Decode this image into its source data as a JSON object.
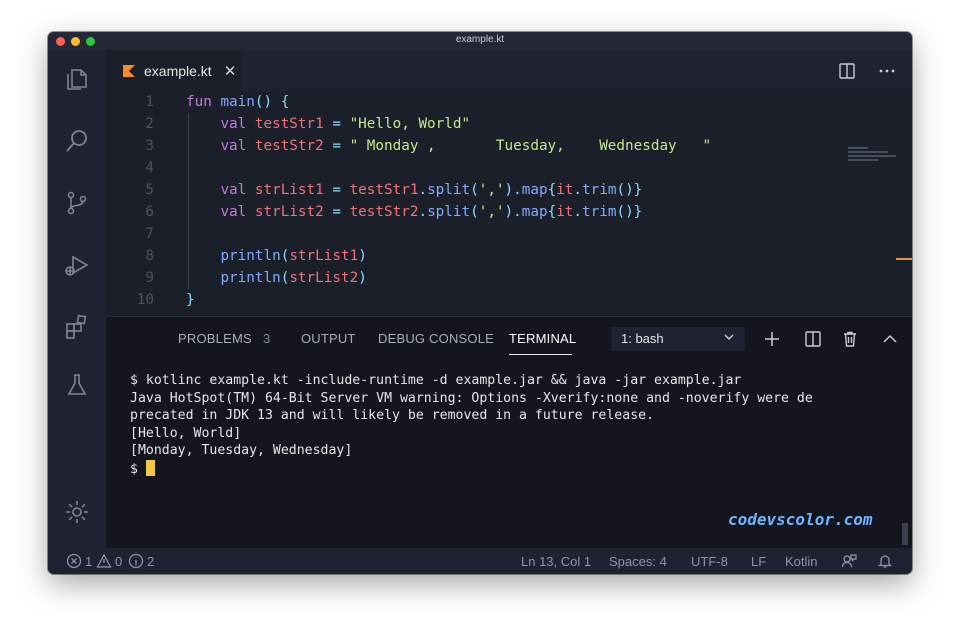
{
  "window": {
    "title": "example.kt"
  },
  "activity_bar": {
    "icons": [
      "files-icon",
      "search-icon",
      "source-control-icon",
      "debug-icon",
      "extensions-icon",
      "flask-icon",
      "gear-icon"
    ]
  },
  "editor": {
    "tab": {
      "label": "example.kt",
      "close": "✕"
    },
    "line_numbers": [
      "1",
      "2",
      "3",
      "4",
      "5",
      "6",
      "7",
      "8",
      "9",
      "10"
    ]
  },
  "panel": {
    "tabs": {
      "problems": "PROBLEMS",
      "problems_count": "3",
      "output": "OUTPUT",
      "debug_console": "DEBUG CONSOLE",
      "terminal": "TERMINAL"
    },
    "terminal_select": "1: bash",
    "terminal_lines": [
      "$ kotlinc example.kt -include-runtime -d example.jar && java -jar example.jar",
      "Java HotSpot(TM) 64-Bit Server VM warning: Options -Xverify:none and -noverify were de",
      "precated in JDK 13 and will likely be removed in a future release.",
      "[Hello, World]",
      "[Monday, Tuesday, Wednesday]"
    ],
    "prompt": "$ ",
    "watermark": "codevscolor.com"
  },
  "status_bar": {
    "errors": "1",
    "warnings": "0",
    "infos": "2",
    "position": "Ln 13, Col 1",
    "spaces": "Spaces: 4",
    "encoding": "UTF-8",
    "eol": "LF",
    "language": "Kotlin"
  },
  "colors": {
    "keyword": "#c678dd",
    "function": "#82aaff",
    "variable": "#f07178",
    "string": "#c3e88d",
    "cursor": "#f2c744",
    "watermark": "#6fb4ff"
  }
}
